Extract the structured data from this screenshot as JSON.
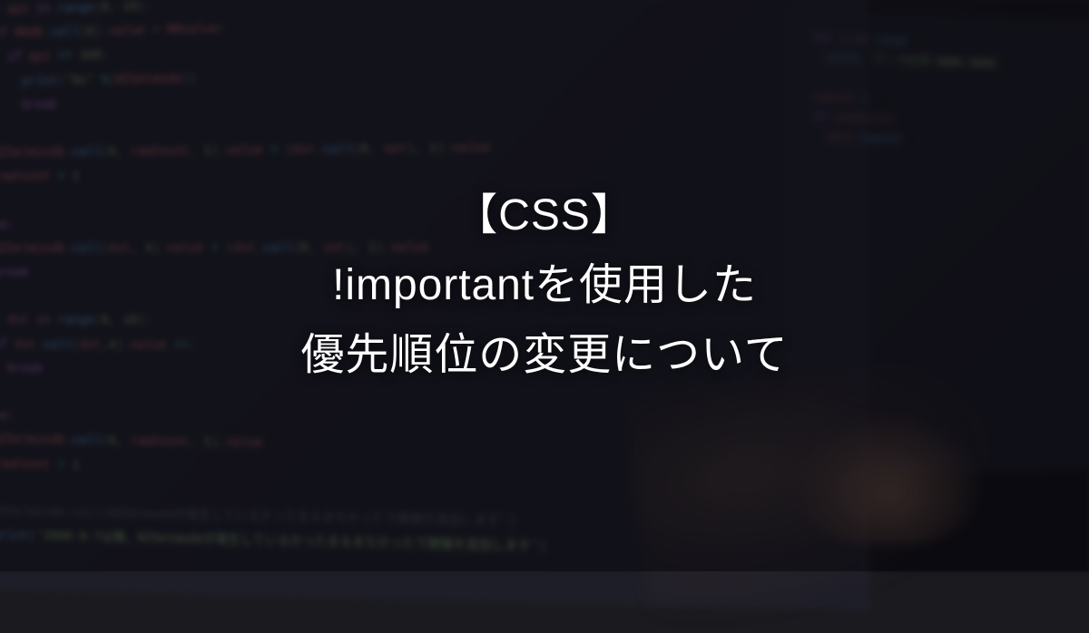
{
  "title": {
    "line1": "【CSS】",
    "line2": "!importantを使用した",
    "line3": "優先順位の変更について"
  },
  "background_code": {
    "lines": [
      "for api in range(0, 10):",
      "  if MRdb.call(0).value > MRvalue:",
      "    if api == 100:",
      "      print('%s' %(RZSetmode))",
      "      break",
      "",
      "  NZSelmindb.call(0, rawCount, 1).value = (dst.call(0, set), 1).value",
      "  rowCount = 1",
      "",
      "else:",
      "  NZSelmindb.call(dst, 4).value = (dst.call(0, set), 1).value",
      "  break",
      "",
      "for dst in range(0, 10):",
      "  if dst.call(dst,4).value ==:",
      "    break",
      "",
      "else:",
      "  NZSelmindb.call(0, rawCount, 1).value",
      "  rowCount = 1",
      "",
      "  NZSelmindb.call(NZSetmodeが発生しているかったまるまなかったで開催を追加します')",
      "  print('2008-8-7以降、NZSetmodeが発生しているかったまるまなかったで開催を追加します')"
    ]
  }
}
